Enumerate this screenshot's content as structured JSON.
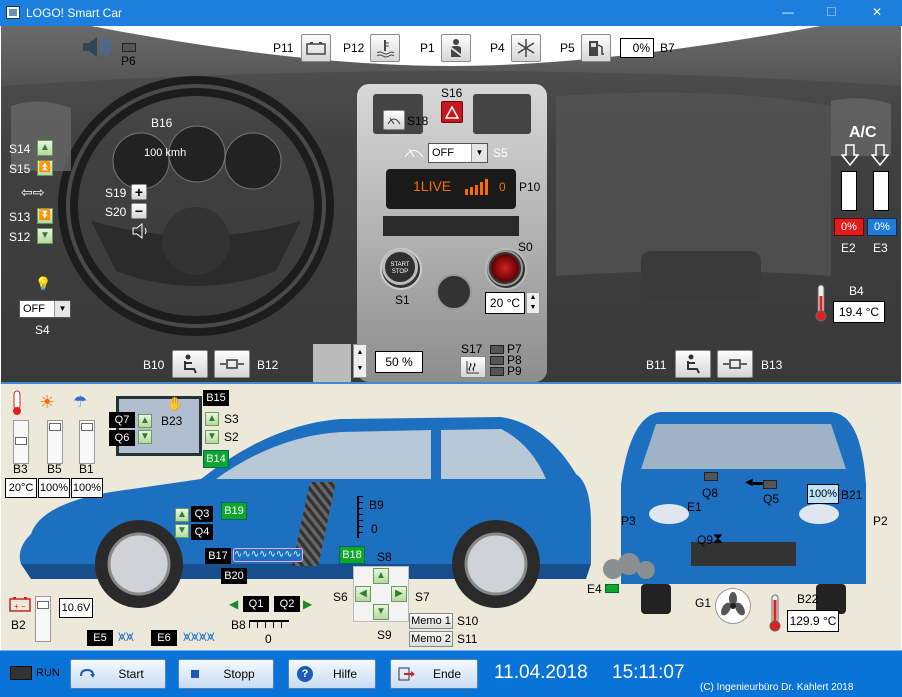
{
  "window": {
    "title": "LOGO! Smart Car",
    "minimize": "—",
    "maximize": "☐",
    "close": "✕"
  },
  "dashboard": {
    "p6": "P6",
    "p11": "P11",
    "p12": "P12",
    "p1": "P1",
    "p4": "P4",
    "p5": "P5",
    "b7_value": "0%",
    "b7": "B7",
    "s16": "S16",
    "s18": "S18",
    "b16": "B16",
    "speed": "100 kmh",
    "s14": "S14",
    "s15": "S15",
    "s13": "S13",
    "s12": "S12",
    "s19": "S19",
    "s20": "S20",
    "wiper_value": "OFF",
    "s5": "S5",
    "radio": "1LIVE",
    "radio_num": "0",
    "p10": "P10",
    "s1": "S1",
    "start_stop": "START STOP",
    "s0": "S0",
    "temp_setting": "20 °C",
    "s4_value": "OFF",
    "s4": "S4",
    "ac": "A/C",
    "e2_value": "0%",
    "e3_value": "0%",
    "e2": "E2",
    "e3": "E3",
    "b4": "B4",
    "b4_value": "19.4 °C",
    "b10": "B10",
    "b12": "B12",
    "seat_value": "50 %",
    "s17": "S17",
    "p7": "P7",
    "p8": "P8",
    "p9": "P9",
    "b11": "B11",
    "b13": "B13"
  },
  "vehicle": {
    "b3": "B3",
    "b5": "B5",
    "b1": "B1",
    "b3_value": "20°C",
    "b5_value": "100%",
    "b1_value": "100%",
    "q7": "Q7",
    "q6": "Q6",
    "b23": "B23",
    "b15": "B15",
    "s3": "S3",
    "s2": "S2",
    "b14": "B14",
    "b19": "B19",
    "q3": "Q3",
    "q4": "Q4",
    "b17": "B17",
    "b20": "B20",
    "b18": "B18",
    "b9": "B9",
    "b9_value": "0",
    "s8": "S8",
    "s6": "S6",
    "s7": "S7",
    "s9": "S9",
    "memo1": "Memo 1",
    "memo2": "Memo 2",
    "s10": "S10",
    "s11": "S11",
    "b2": "B2",
    "b2_value": "10.6V",
    "q1": "Q1",
    "q2": "Q2",
    "b8": "B8",
    "b8_value": "0",
    "e5": "E5",
    "e6": "E6",
    "q8": "Q8",
    "q5": "Q5",
    "b21_value": "100%",
    "b21": "B21",
    "e1": "E1",
    "p3": "P3",
    "p2": "P2",
    "q9": "Q9",
    "e4": "E4",
    "g1": "G1",
    "b22": "B22",
    "b22_value": "129.9 °C"
  },
  "toolbar": {
    "run": "RUN",
    "start": "Start",
    "stop": "Stopp",
    "help": "Hilfe",
    "end": "Ende",
    "date": "11.04.2018",
    "time": "15:11:07",
    "copyright": "(C) Ingenieurbüro Dr. Kahlert 2018"
  },
  "colors": {
    "titlebar": "#1d7fdd",
    "toolbar": "#0a73d8",
    "car": "#1d6fc0",
    "panel": "#ede9da",
    "green": "#0ca82e"
  }
}
